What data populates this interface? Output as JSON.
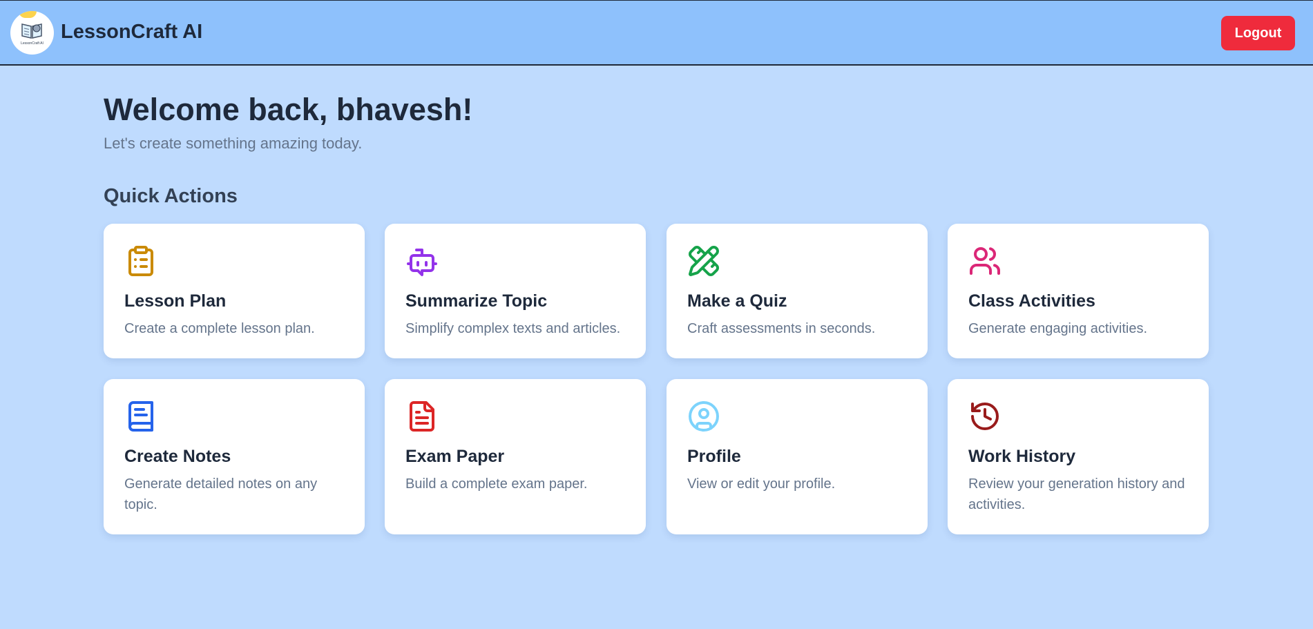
{
  "app": {
    "name": "LessonCraft AI",
    "logo_text": "LessonCraft AI",
    "logout_label": "Logout"
  },
  "main": {
    "welcome": "Welcome back, bhavesh!",
    "subtitle": "Let's create something amazing today.",
    "section_title": "Quick Actions"
  },
  "cards": [
    {
      "title": "Lesson Plan",
      "desc": "Create a complete lesson plan.",
      "icon": "clipboard-icon",
      "color": "#ca8a04"
    },
    {
      "title": "Summarize Topic",
      "desc": "Simplify complex texts and articles.",
      "icon": "robot-icon",
      "color": "#9333ea"
    },
    {
      "title": "Make a Quiz",
      "desc": "Craft assessments in seconds.",
      "icon": "pencil-ruler-icon",
      "color": "#16a34a"
    },
    {
      "title": "Class Activities",
      "desc": "Generate engaging activities.",
      "icon": "users-icon",
      "color": "#db2777"
    },
    {
      "title": "Create Notes",
      "desc": "Generate detailed notes on any topic.",
      "icon": "book-icon",
      "color": "#2563eb"
    },
    {
      "title": "Exam Paper",
      "desc": "Build a complete exam paper.",
      "icon": "document-icon",
      "color": "#dc2626"
    },
    {
      "title": "Profile",
      "desc": "View or edit your profile.",
      "icon": "user-circle-icon",
      "color": "#7dd3fc"
    },
    {
      "title": "Work History",
      "desc": "Review your generation history and activities.",
      "icon": "history-icon",
      "color": "#991b1b"
    }
  ]
}
